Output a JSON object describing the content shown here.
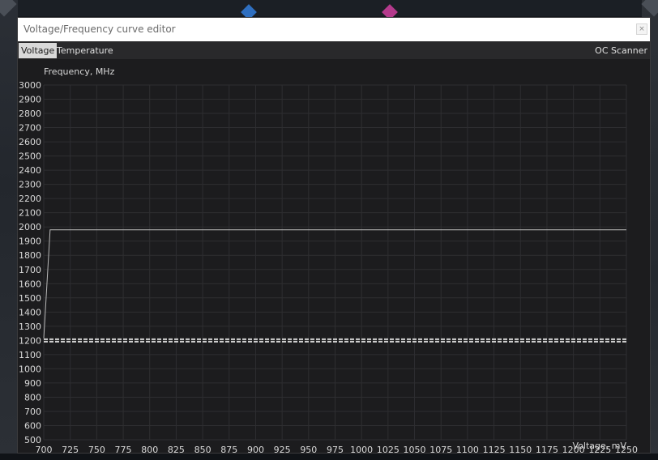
{
  "window": {
    "title": "Voltage/Frequency curve editor",
    "close_glyph": "×"
  },
  "tabs": [
    {
      "label": "Voltage",
      "active": true
    },
    {
      "label": "Temperature",
      "active": false
    }
  ],
  "oc_scanner_label": "OC Scanner",
  "colors": {
    "curve": "#b9b9b9",
    "grid": "#2e2e31",
    "axis_text": "#d9d9d9",
    "marker": "#d2d2d2"
  },
  "chart_data": {
    "type": "line",
    "ylabel": "Frequency, MHz",
    "xlabel": "Voltage, mV",
    "xlim": [
      700,
      1250
    ],
    "ylim": [
      500,
      3000
    ],
    "x_ticks": [
      700,
      725,
      750,
      775,
      800,
      825,
      850,
      875,
      900,
      925,
      950,
      975,
      1000,
      1025,
      1050,
      1075,
      1100,
      1125,
      1150,
      1175,
      1200,
      1225,
      1250
    ],
    "y_ticks": [
      500,
      600,
      700,
      800,
      900,
      1000,
      1100,
      1200,
      1300,
      1400,
      1500,
      1600,
      1700,
      1800,
      1900,
      2000,
      2100,
      2200,
      2300,
      2400,
      2500,
      2600,
      2700,
      2800,
      2900,
      3000
    ],
    "grid": true,
    "series": [
      {
        "x": [
          700,
          706,
          1250
        ],
        "y": [
          1215,
          1980,
          1980
        ]
      }
    ],
    "reference_line": {
      "y": 1200,
      "style": "dashed"
    }
  }
}
